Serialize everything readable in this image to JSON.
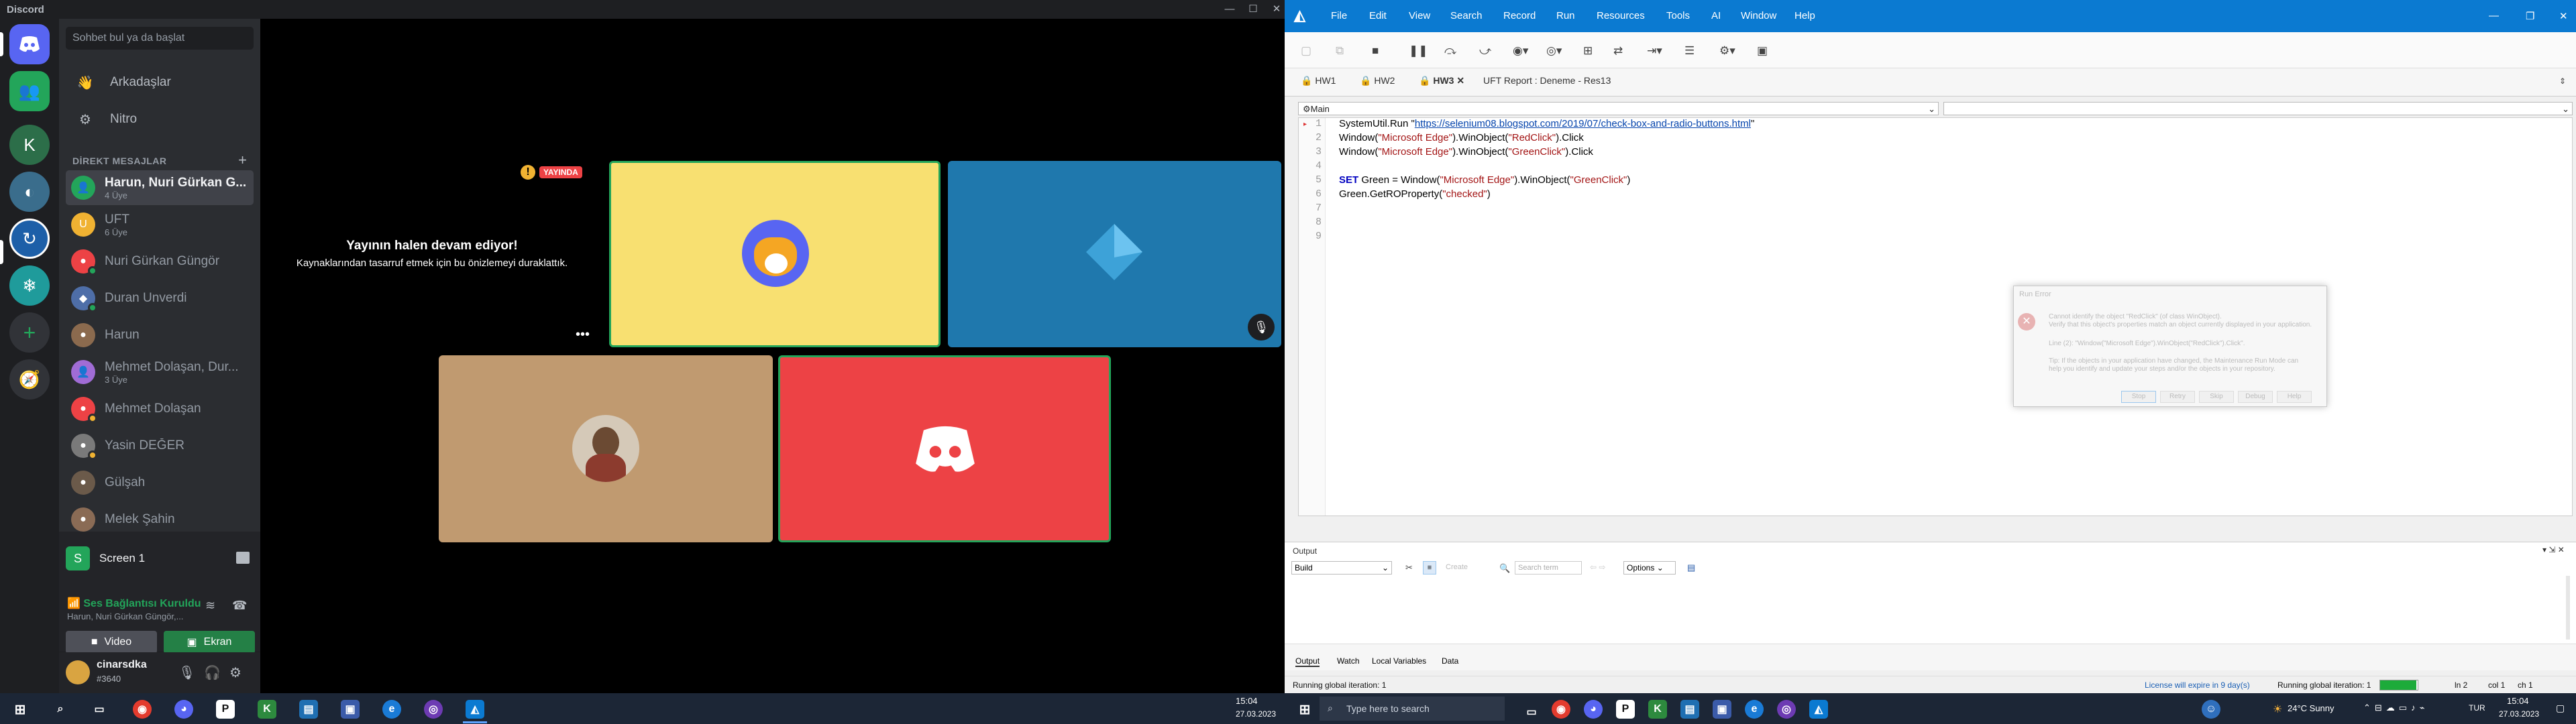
{
  "discord": {
    "window_title": "Discord",
    "search_placeholder": "Sohbet bul ya da başlat",
    "nav": {
      "friends": "Arkadaşlar",
      "nitro": "Nitro"
    },
    "dm_header": "DİREKT MESAJLAR",
    "dms": [
      {
        "name": "Harun, Nuri Gürkan G...",
        "sub": "4 Üye",
        "color": "#23a55a",
        "selected": true
      },
      {
        "name": "UFT",
        "sub": "6 Üye",
        "color": "#f0b232"
      },
      {
        "name": "Nuri Gürkan Güngör",
        "sub": "",
        "color": "#ed4245"
      },
      {
        "name": "Duran Unverdi",
        "sub": "",
        "color": "#4e6ea8"
      },
      {
        "name": "Harun",
        "sub": "",
        "color": "#8b6a4e"
      },
      {
        "name": "Mehmet Dolaşan, Dur...",
        "sub": "3 Üye",
        "color": "#a06cd5"
      },
      {
        "name": "Mehmet Dolaşan",
        "sub": "",
        "color": "#ed4245"
      },
      {
        "name": "Yasin DEĞER",
        "sub": "",
        "color": "#7a7a7a"
      },
      {
        "name": "Gülşah",
        "sub": "",
        "color": "#6b5a4a"
      },
      {
        "name": "Melek Şahin",
        "sub": "",
        "color": "#8a6b55"
      }
    ],
    "screen_share_label": "Screen 1",
    "voice": {
      "status": "Ses Bağlantısı Kuruldu",
      "sub": "Harun, Nuri Gürkan Güngör,...",
      "video": "Video",
      "screen": "Ekran"
    },
    "user": {
      "name": "cinarsdka",
      "tag": "#3640"
    },
    "stream": {
      "badge": "YAYINDA",
      "title": "Yayının halen devam ediyor!",
      "body": "Kaynaklarından tasarruf etmek için bu önizlemeyi duraklattık."
    },
    "colors": {
      "accent": "#5865f2",
      "green": "#23a55a",
      "live": "#ed4245"
    }
  },
  "uft": {
    "menus": [
      "File",
      "Edit",
      "View",
      "Search",
      "Record",
      "Run",
      "Resources",
      "Tools",
      "AI",
      "Window",
      "Help"
    ],
    "tabs": [
      "HW1",
      "HW2",
      "HW3",
      "UFT Report : Deneme - Res13"
    ],
    "object_combo": "Main",
    "line_numbers": [
      "1",
      "2",
      "3",
      "4",
      "5",
      "6",
      "7",
      "8",
      "9"
    ],
    "code": {
      "l1a": "SystemUtil.Run \"",
      "l1url": "https://selenium08.blogspot.com/2019/07/check-box-and-radio-buttons.html",
      "l1b": "\"",
      "l2a": "Window(",
      "l2s1": "\"Microsoft Edge\"",
      "l2b": ").WinObject(",
      "l2s2": "\"RedClick\"",
      "l2c": ").Click",
      "l3a": "Window(",
      "l3s1": "\"Microsoft Edge\"",
      "l3b": ").WinObject(",
      "l3s2": "\"GreenClick\"",
      "l3c": ").Click",
      "l5k": "SET",
      "l5a": " Green = Window(",
      "l5s1": "\"Microsoft Edge\"",
      "l5b": ").WinObject(",
      "l5s2": "\"GreenClick\"",
      "l5c": ")",
      "l6a": "Green.GetROProperty(",
      "l6s1": "\"checked\"",
      "l6b": ")"
    },
    "dialog": {
      "title": "Run Error",
      "line1": "Cannot identify the object \"RedClick\" (of class WinObject).",
      "line2": "Verify that this object's properties match an object currently displayed in your application.",
      "line3": "Line (2): \"Window(\"Microsoft Edge\").WinObject(\"RedClick\").Click\".",
      "line4": "Tip: If the objects in your application have changed, the Maintenance Run Mode can",
      "line5": "help you identify and update your steps and/or the objects in your repository.",
      "buttons": [
        "Stop",
        "Retry",
        "Skip",
        "Debug",
        "Help"
      ]
    },
    "output": {
      "title": "Output",
      "select": "Build",
      "search_placeholder": "Search term",
      "options": "Options",
      "create": "Create"
    },
    "bottom_tabs": [
      "Output",
      "Watch",
      "Local Variables",
      "Data"
    ],
    "status": {
      "left": "Running global iteration: 1",
      "license": "License will expire in 9 day(s)",
      "iter": "Running global iteration: 1",
      "ln": "ln 2",
      "col": "col 1",
      "ch": "ch 1"
    }
  },
  "taskbar": {
    "time": "15:04",
    "date": "27.03.2023",
    "search_placeholder": "Type here to search",
    "weather": "24°C Sunny",
    "lang": "TUR"
  }
}
